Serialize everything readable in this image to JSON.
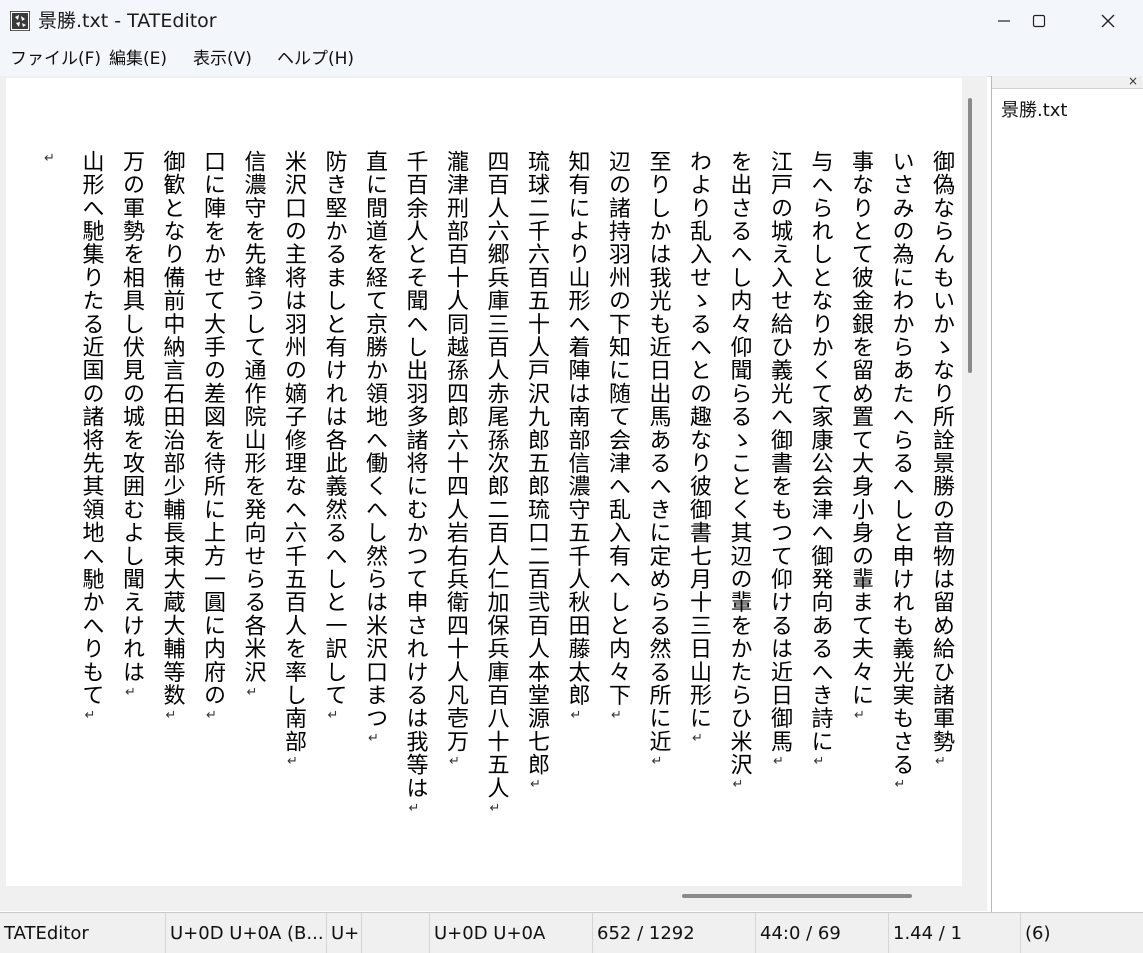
{
  "window": {
    "title": "景勝.txt - TATEditor",
    "app_icon": "tateditor-app-icon"
  },
  "menu": {
    "file": "ファイル(F)",
    "edit": "編集(E)",
    "view": "表示(V)",
    "help": "ヘルプ(H)"
  },
  "document": {
    "return_mark": "↵",
    "lines": [
      "御偽ならんもいかゝなり所詮景勝の音物は留め給ひ諸軍勢",
      "いさみの為にわからあたへらるへしと申けれも義光実もさる",
      "事なりとて彼金銀を留め置て大身小身の輩まて夫々に",
      "与へられしとなりかくて家康公会津へ御発向あるへき詩に",
      "江戸の城え入せ給ひ義光へ御書をもつて仰けるは近日御馬",
      "を出さるへし内々仰聞らるゝことく其辺の輩をかたらひ米沢",
      "わより乱入せゝるへとの趣なり彼御書七月十三日山形に",
      "至りしかは我光も近日出馬あるへきに定めらる然る所に近",
      "辺の諸持羽州の下知に随て会津へ乱入有へしと内々下",
      "知有により山形へ着陣は南部信濃守五千人秋田藤太郎",
      "琉球二千六百五十人戸沢九郎五郎琉口二百弐百人本堂源七郎",
      "四百人六郷兵庫三百人赤尾孫次郎二百人仁加保兵庫百八十五人",
      "瀧津刑部百十人同越孫四郎六十四人岩右兵衛四十人凡壱万",
      "千百余人とそ聞へし出羽多諸将にむかつて申されけるは我等は",
      "直に間道を経て京勝か領地へ働くへし然らは米沢口まつ",
      "防き堅かるましと有けれは各此義然るへしと一訳して",
      "米沢口の主将は羽州の嫡子修理なへ六千五百人を率し南部",
      "信濃守を先鋒うして通作院山形を発向せらる各米沢",
      "口に陣をかせて大手の差図を待所に上方一圓に内府の",
      "御歓となり備前中納言石田治部少輔長束大蔵大輔等数",
      "万の軍勢を相具し伏見の城を攻囲むよし聞えけれは",
      "山形へ馳集りたる近国の諸将先其領地へ馳かへりもて",
      ""
    ]
  },
  "side_panel": {
    "close_glyph": "×",
    "file": "景勝.txt"
  },
  "status": {
    "app": "TATEditor",
    "char_desc": "U+0D U+0A (B...",
    "unicode_short": "U+",
    "blank": "",
    "char_codes": "U+0D U+0A",
    "position": "652 / 1292",
    "line_col": "44:0 / 69",
    "ratio": "1.44 / 1",
    "count": "(6)"
  }
}
